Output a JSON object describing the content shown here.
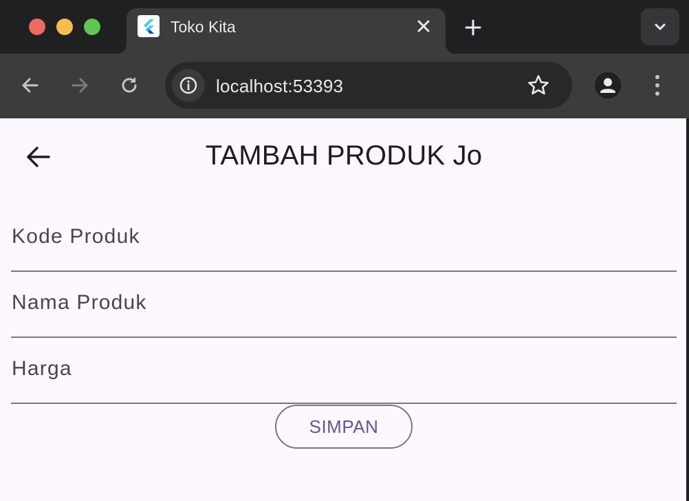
{
  "browser": {
    "tab": {
      "title": "Toko Kita",
      "favicon": "flutter-icon"
    },
    "address_bar": {
      "url": "localhost:53393"
    },
    "colors": {
      "close": "#ee6a5e",
      "minimize": "#f5bf4f",
      "maximize": "#61c454"
    },
    "icons": {
      "new_tab": "plus-icon",
      "tab_close": "close-icon",
      "tab_search": "chevron-down-icon",
      "back": "arrow-left-icon",
      "forward": "arrow-right-icon",
      "reload": "reload-icon",
      "site_info": "info-icon",
      "bookmark": "star-icon",
      "profile": "person-icon",
      "menu": "more-vert-icon"
    }
  },
  "app": {
    "title": "TAMBAH PRODUK Jo",
    "back_icon": "arrow-left-icon",
    "form": {
      "fields": [
        {
          "label": "Kode Produk",
          "value": ""
        },
        {
          "label": "Nama Produk",
          "value": ""
        },
        {
          "label": "Harga",
          "value": ""
        }
      ],
      "submit_label": "SIMPAN"
    },
    "colors": {
      "background": "#fdf7ff",
      "primary": "#65558f",
      "outline": "#79747e"
    }
  }
}
